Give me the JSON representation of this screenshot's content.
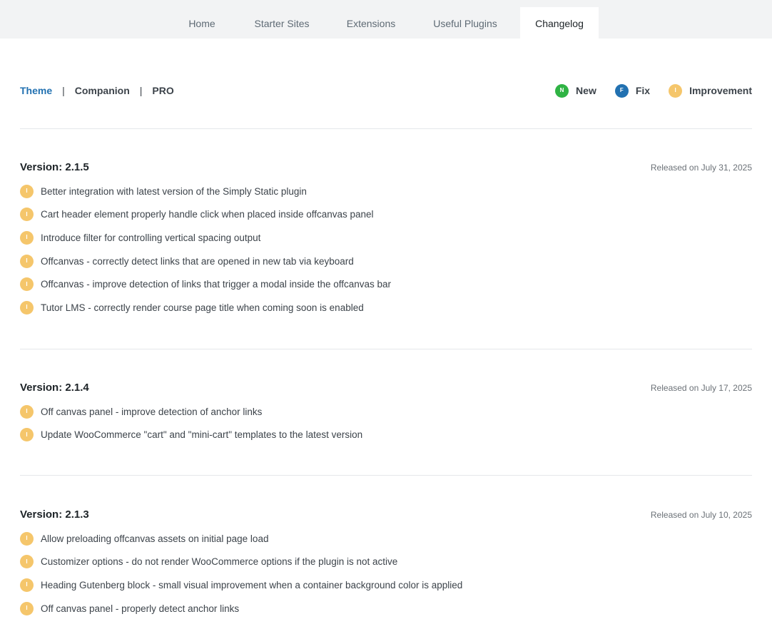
{
  "tabs": [
    {
      "label": "Home",
      "active": false
    },
    {
      "label": "Starter Sites",
      "active": false
    },
    {
      "label": "Extensions",
      "active": false
    },
    {
      "label": "Useful Plugins",
      "active": false
    },
    {
      "label": "Changelog",
      "active": true
    }
  ],
  "subnav": {
    "theme": "Theme",
    "companion": "Companion",
    "pro": "PRO",
    "separator": "|"
  },
  "legend": {
    "new": {
      "glyph": "N",
      "label": "New",
      "color": "#2fb344"
    },
    "fix": {
      "glyph": "F",
      "label": "Fix",
      "color": "#2271b1"
    },
    "improvement": {
      "glyph": "I",
      "label": "Improvement",
      "color": "#f5c66b"
    }
  },
  "versions": [
    {
      "title": "Version: 2.1.5",
      "released": "Released on July 31, 2025",
      "items": [
        {
          "type": "improvement",
          "glyph": "I",
          "text": "Better integration with latest version of the Simply Static plugin"
        },
        {
          "type": "improvement",
          "glyph": "I",
          "text": "Cart header element properly handle click when placed inside offcanvas panel"
        },
        {
          "type": "improvement",
          "glyph": "I",
          "text": "Introduce filter for controlling vertical spacing output"
        },
        {
          "type": "improvement",
          "glyph": "I",
          "text": "Offcanvas - correctly detect links that are opened in new tab via keyboard"
        },
        {
          "type": "improvement",
          "glyph": "I",
          "text": "Offcanvas - improve detection of links that trigger a modal inside the offcanvas bar"
        },
        {
          "type": "improvement",
          "glyph": "I",
          "text": "Tutor LMS - correctly render course page title when coming soon is enabled"
        }
      ]
    },
    {
      "title": "Version: 2.1.4",
      "released": "Released on July 17, 2025",
      "items": [
        {
          "type": "improvement",
          "glyph": "I",
          "text": "Off canvas panel - improve detection of anchor links"
        },
        {
          "type": "improvement",
          "glyph": "I",
          "text": "Update WooCommerce \"cart\" and \"mini-cart\" templates to the latest version"
        }
      ]
    },
    {
      "title": "Version: 2.1.3",
      "released": "Released on July 10, 2025",
      "items": [
        {
          "type": "improvement",
          "glyph": "I",
          "text": "Allow preloading offcanvas assets on initial page load"
        },
        {
          "type": "improvement",
          "glyph": "I",
          "text": "Customizer options - do not render WooCommerce options if the plugin is not active"
        },
        {
          "type": "improvement",
          "glyph": "I",
          "text": "Heading Gutenberg block - small visual improvement when a container background color is applied"
        },
        {
          "type": "improvement",
          "glyph": "I",
          "text": "Off canvas panel - properly detect anchor links"
        }
      ]
    }
  ]
}
